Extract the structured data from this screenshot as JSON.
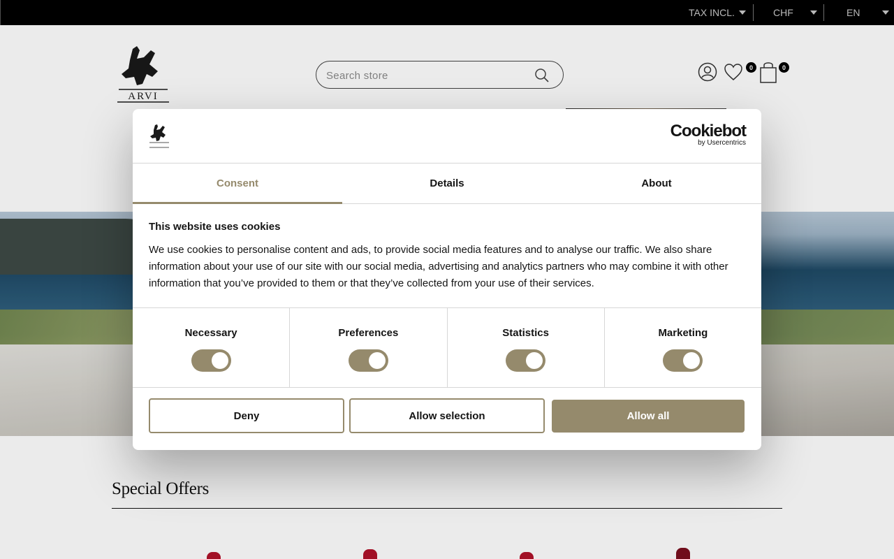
{
  "topbar": {
    "tax_label": "TAX INCL.",
    "currency": "CHF",
    "language": "EN"
  },
  "header": {
    "logo_text": "ARVI",
    "search_placeholder": "Search store",
    "wishlist_count": "0",
    "cart_count": "0"
  },
  "sections": {
    "special_offers_title": "Special Offers"
  },
  "cookie_modal": {
    "brand_main": "Cookiebot",
    "brand_sub": "by Usercentrics",
    "tabs": [
      {
        "label": "Consent",
        "active": true
      },
      {
        "label": "Details",
        "active": false
      },
      {
        "label": "About",
        "active": false
      }
    ],
    "title": "This website uses cookies",
    "text": "We use cookies to personalise content and ads, to provide social media features and to analyse our traffic. We also share information about your use of our site with our social media, advertising and analytics partners who may combine it with other information that you’ve provided to them or that they’ve collected from your use of their services.",
    "toggles": [
      {
        "label": "Necessary",
        "on": true
      },
      {
        "label": "Preferences",
        "on": true
      },
      {
        "label": "Statistics",
        "on": true
      },
      {
        "label": "Marketing",
        "on": true
      }
    ],
    "buttons": {
      "deny": "Deny",
      "allow_selection": "Allow selection",
      "allow_all": "Allow all"
    }
  },
  "colors": {
    "accent": "#958a6c",
    "topbar_bg": "#000000",
    "text": "#141414"
  }
}
